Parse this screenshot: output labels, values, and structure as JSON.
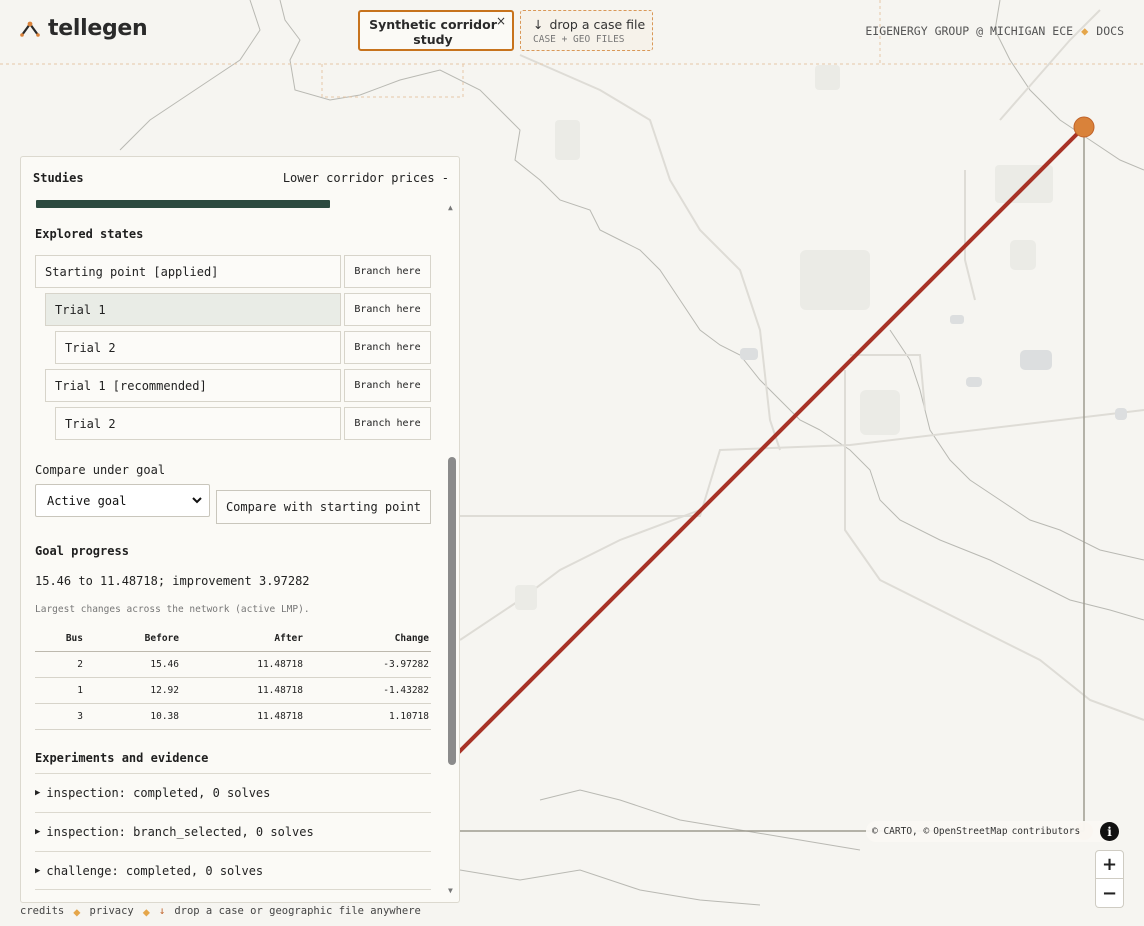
{
  "app": {
    "name": "tellegen"
  },
  "header": {
    "study_tab": {
      "label": "Synthetic corridor study",
      "close": "×"
    },
    "drop_tab": {
      "arrow": "↓",
      "title": "drop a case file",
      "subtitle": "CASE + GEO FILES"
    },
    "right_links": {
      "group": "EIGENERGY GROUP @ MICHIGAN ECE",
      "separator": "◆",
      "docs": "DOCS"
    }
  },
  "panel": {
    "title": "Studies",
    "header_right": "Lower corridor prices -",
    "explored_title": "Explored states",
    "states": [
      {
        "label": "Starting point [applied]",
        "button": "Branch here"
      },
      {
        "label": "Trial 1",
        "button": "Branch here",
        "active": true
      },
      {
        "label": "Trial 2",
        "button": "Branch here"
      },
      {
        "label": "Trial 1 [recommended]",
        "button": "Branch here"
      },
      {
        "label": "Trial 2",
        "button": "Branch here"
      }
    ],
    "compare_label": "Compare under goal",
    "goal_select": {
      "value": "Active goal",
      "options": [
        "Active goal"
      ]
    },
    "compare_button": "Compare with starting point",
    "goal_progress_title": "Goal progress",
    "goal_progress_text": "15.46 to 11.48718; improvement 3.97282",
    "table_note": "Largest changes across the network (active LMP).",
    "table": {
      "headers": [
        "Bus",
        "Before",
        "After",
        "Change"
      ],
      "rows": [
        [
          "2",
          "15.46",
          "11.48718",
          "-3.97282"
        ],
        [
          "1",
          "12.92",
          "11.48718",
          "-1.43282"
        ],
        [
          "3",
          "10.38",
          "11.48718",
          "1.10718"
        ]
      ]
    },
    "experiments_title": "Experiments and evidence",
    "experiments": [
      "inspection: completed, 0 solves",
      "inspection: branch_selected, 0 solves",
      "challenge: completed, 0 solves"
    ]
  },
  "map": {
    "attribution": {
      "carto": "© CARTO, ©",
      "osm": "OpenStreetMap",
      "contributors": "contributors"
    },
    "info": "i",
    "zoom_in": "+",
    "zoom_out": "−",
    "colors": {
      "line": "#a83327",
      "node": "#d9823a",
      "land": "#f6f5f1",
      "boundary": "#b8b8b0"
    }
  },
  "footer": {
    "credits": "credits",
    "privacy": "privacy",
    "separator": "◆",
    "arrow": "↓",
    "drop_text": "drop a case or geographic file anywhere"
  }
}
